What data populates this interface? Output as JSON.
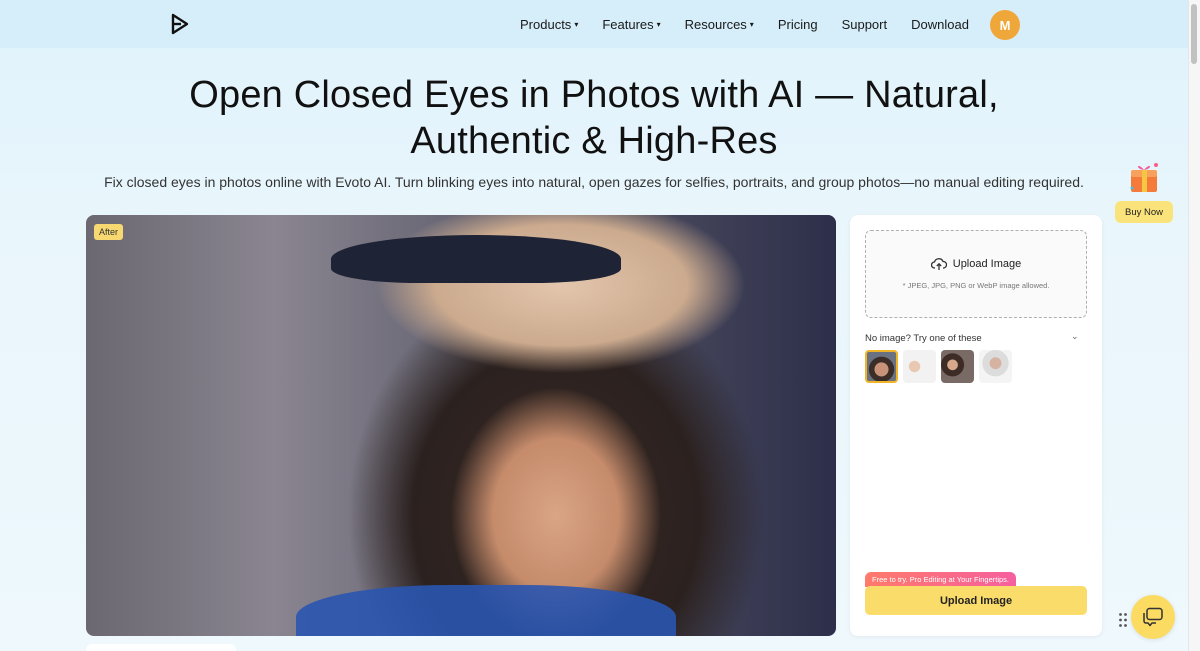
{
  "header": {
    "nav": [
      {
        "label": "Products",
        "has_caret": true
      },
      {
        "label": "Features",
        "has_caret": true
      },
      {
        "label": "Resources",
        "has_caret": true
      },
      {
        "label": "Pricing",
        "has_caret": false
      },
      {
        "label": "Support",
        "has_caret": false
      },
      {
        "label": "Download",
        "has_caret": false
      }
    ],
    "caret_glyph": "▾",
    "avatar_initial": "M",
    "logo_icon": "evoto-logo-icon"
  },
  "hero": {
    "title_line1": "Open Closed Eyes in Photos with AI — Natural,",
    "title_line2": "Authentic & High-Res",
    "subtitle": "Fix closed eyes in photos online with Evoto AI. Turn blinking eyes into natural, open gazes for selfies, portraits, and group photos—no manual editing required."
  },
  "preview": {
    "badge": "After"
  },
  "upload_card": {
    "dropzone_label": "Upload Image",
    "dropzone_hint": "* JPEG, JPG, PNG or WebP image allowed.",
    "samples_label": "No image? Try one of these",
    "promo_tag": "Free to try. Pro Editing at Your Fingertips.",
    "button_label": "Upload Image"
  },
  "side": {
    "buy_now": "Buy Now"
  },
  "colors": {
    "accent_yellow": "#fadc6a",
    "avatar_orange": "#f0a73a",
    "header_bg": "#d6eefa"
  }
}
